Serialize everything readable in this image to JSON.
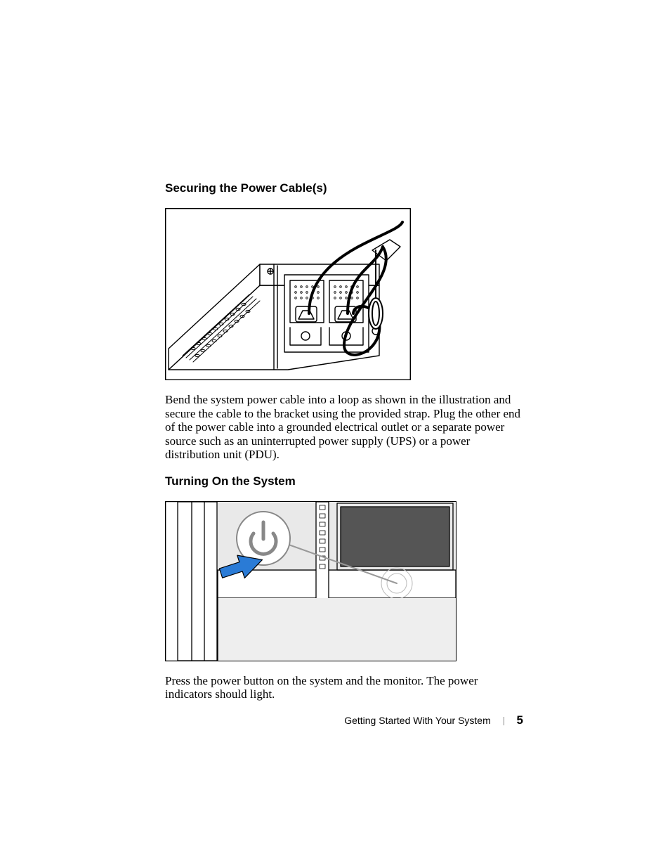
{
  "sections": {
    "securing": {
      "heading": "Securing the Power Cable(s)",
      "paragraph": "Bend the system power cable into a loop as shown in the illustration and secure the cable to the bracket using the provided strap. Plug the other end of the power cable into a grounded electrical outlet or a separate power source such as an uninterrupted power supply (UPS) or a power distribution unit (PDU)."
    },
    "turning_on": {
      "heading": "Turning On the System",
      "paragraph": "Press the power button on the system and the monitor. The power indicators should light."
    }
  },
  "footer": {
    "chapter_title": "Getting Started With Your System",
    "page_number": "5"
  },
  "icons": {
    "figure1": "power-cable-loop-illustration",
    "figure2": "power-button-press-illustration",
    "power_symbol": "power-icon",
    "arrow": "blue-arrow-icon"
  }
}
